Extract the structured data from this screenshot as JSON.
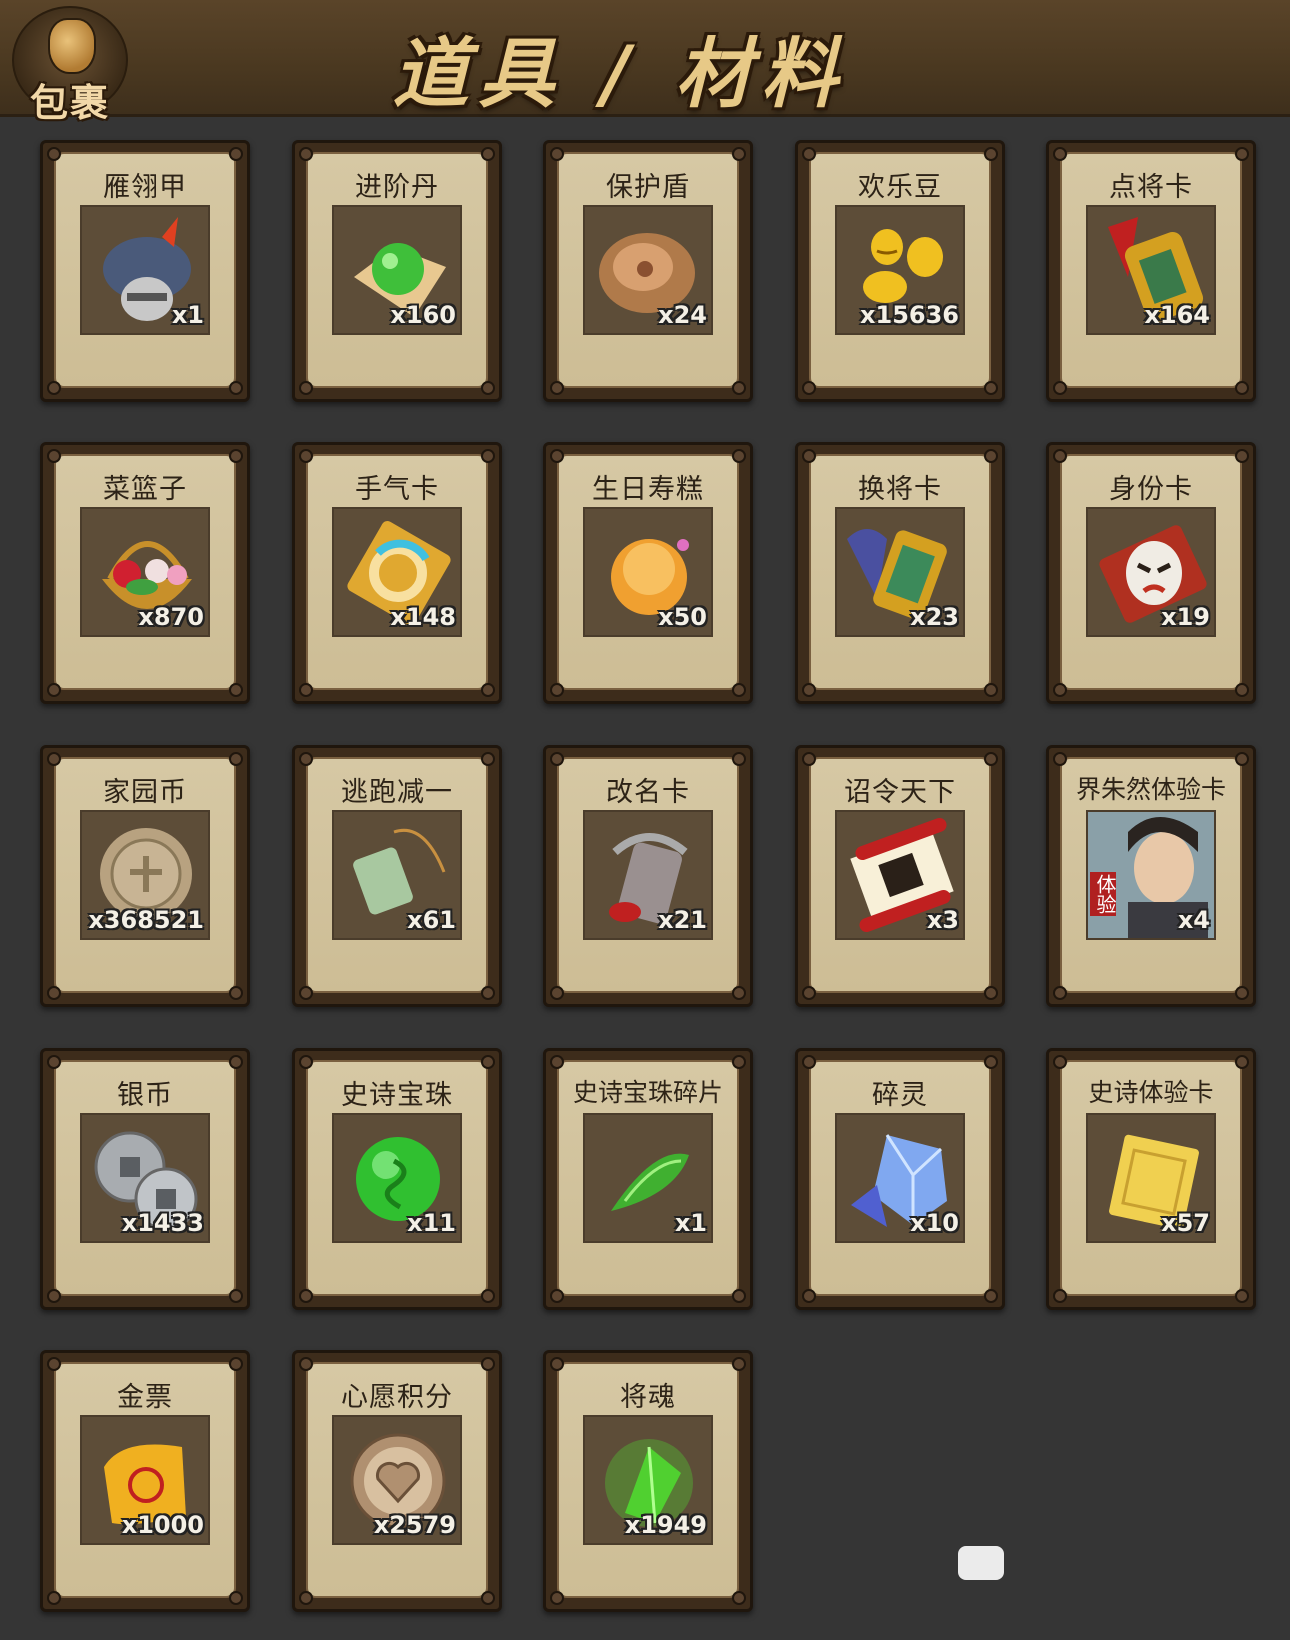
{
  "header": {
    "bag_label": "包裹",
    "title": "道具 / 材料"
  },
  "items": [
    {
      "name": "雁翎甲",
      "qty": "x1",
      "icon": "armor-helmet-icon",
      "color": "#4a5a7a"
    },
    {
      "name": "进阶丹",
      "qty": "x160",
      "icon": "green-pill-icon",
      "color": "#3fbf3a"
    },
    {
      "name": "保护盾",
      "qty": "x24",
      "icon": "bronze-shield-icon",
      "color": "#b07a4a"
    },
    {
      "name": "欢乐豆",
      "qty": "x15636",
      "icon": "gold-beans-icon",
      "color": "#f0c020"
    },
    {
      "name": "点将卡",
      "qty": "x164",
      "icon": "general-token-icon",
      "color": "#d4a020"
    },
    {
      "name": "菜篮子",
      "qty": "x870",
      "icon": "flower-basket-icon",
      "color": "#c8902a"
    },
    {
      "name": "手气卡",
      "qty": "x148",
      "icon": "luck-card-icon",
      "color": "#e0a830"
    },
    {
      "name": "生日寿糕",
      "qty": "x50",
      "icon": "birthday-cake-icon",
      "color": "#f0a030"
    },
    {
      "name": "换将卡",
      "qty": "x23",
      "icon": "swap-general-token-icon",
      "color": "#3c8a5a"
    },
    {
      "name": "身份卡",
      "qty": "x19",
      "icon": "opera-mask-icon",
      "color": "#b03020"
    },
    {
      "name": "家园币",
      "qty": "x368521",
      "icon": "home-coin-icon",
      "color": "#b8a280"
    },
    {
      "name": "逃跑减一",
      "qty": "x61",
      "icon": "jade-pendant-icon",
      "color": "#a8c8a0"
    },
    {
      "name": "改名卡",
      "qty": "x21",
      "icon": "name-plate-icon",
      "color": "#9a9090"
    },
    {
      "name": "诏令天下",
      "qty": "x3",
      "icon": "imperial-scroll-icon",
      "color": "#e0a020"
    },
    {
      "name": "界朱然体验卡",
      "qty": "x4",
      "icon": "hero-portrait-icon",
      "color": "#6a8090",
      "badge": "体验"
    },
    {
      "name": "银币",
      "qty": "x1433",
      "icon": "silver-coins-icon",
      "color": "#a8acb0"
    },
    {
      "name": "史诗宝珠",
      "qty": "x11",
      "icon": "epic-orb-icon",
      "color": "#30c030"
    },
    {
      "name": "史诗宝珠碎片",
      "qty": "x1",
      "icon": "orb-shard-icon",
      "color": "#40b030"
    },
    {
      "name": "碎灵",
      "qty": "x10",
      "icon": "crystal-shard-icon",
      "color": "#80a8f0"
    },
    {
      "name": "史诗体验卡",
      "qty": "x57",
      "icon": "gold-card-icon",
      "color": "#f0d050"
    },
    {
      "name": "金票",
      "qty": "x1000",
      "icon": "gold-ticket-icon",
      "color": "#f0b020"
    },
    {
      "name": "心愿积分",
      "qty": "x2579",
      "icon": "heart-coin-icon",
      "color": "#b09070"
    },
    {
      "name": "将魂",
      "qty": "x1949",
      "icon": "green-soul-crystal-icon",
      "color": "#50d030"
    }
  ]
}
